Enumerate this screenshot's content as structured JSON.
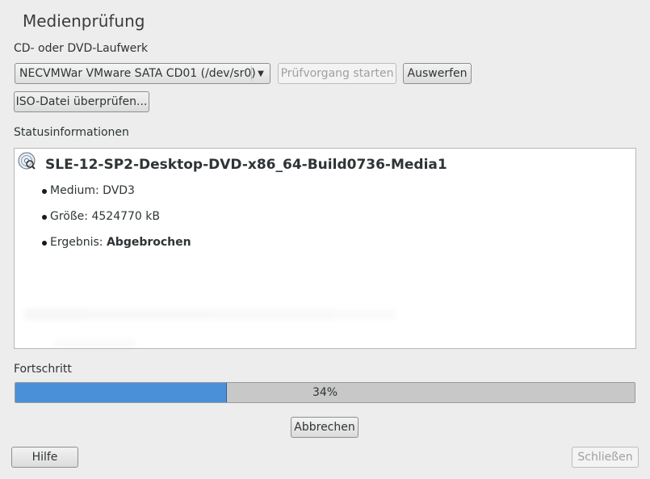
{
  "dialog": {
    "title": "Medienprüfung"
  },
  "drive": {
    "label": "CD- oder DVD-Laufwerk",
    "selected": "NECVMWar VMware SATA CD01 (/dev/sr0)",
    "start_button": "Prüfvorgang starten",
    "eject_button": "Auswerfen",
    "iso_button": "ISO-Datei überprüfen..."
  },
  "status": {
    "label": "Statusinformationen",
    "media_name": "SLE-12-SP2-Desktop-DVD-x86_64-Build0736-Media1",
    "items": [
      {
        "key": "Medium:",
        "value": "DVD3"
      },
      {
        "key": "Größe:",
        "value": "4524770 kB"
      },
      {
        "key": "Ergebnis:",
        "value": "Abgebrochen"
      }
    ]
  },
  "progress": {
    "label": "Fortschritt",
    "value": 0.34,
    "text": "34%"
  },
  "buttons": {
    "cancel": "Abbrechen",
    "help": "Hilfe",
    "close": "Schließen"
  },
  "colors": {
    "progress_fill": "#4a90d9",
    "progress_track": "#c8c8c8"
  },
  "icons": {
    "media": "disc-icon",
    "dropdown": "chevron-down-icon"
  }
}
